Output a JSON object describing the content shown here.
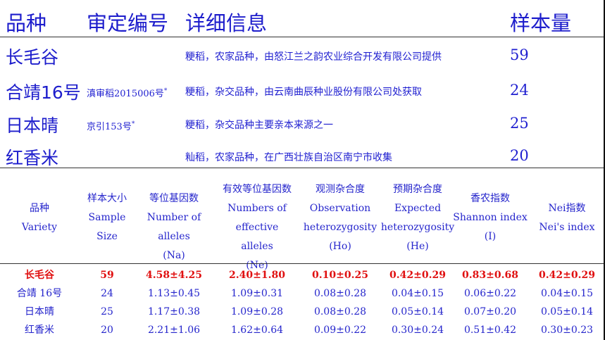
{
  "top_table": {
    "headers": [
      "品种",
      "审定编号",
      "详细信息",
      "样本量"
    ],
    "rows": [
      {
        "name": "长毛谷",
        "code": "",
        "mark": "",
        "desc": "粳稻，农家品种，由怒江兰之韵农业综合开发有限公司提供",
        "count": "59"
      },
      {
        "name": "合靖16号",
        "code": "滇审稻2015006号",
        "mark": "*",
        "desc": "粳稻，杂交品种，由云南曲辰种业股份有限公司处获取",
        "count": "24"
      },
      {
        "name": "日本晴",
        "code": "京引153号",
        "mark": "*",
        "desc": "粳稻，杂交品种主要亲本来源之一",
        "count": "25"
      },
      {
        "name": "红香米",
        "code": "",
        "mark": "",
        "desc": "籼稻，农家品种，在广西壮族自治区南宁市收集",
        "count": "20"
      }
    ]
  },
  "stats_table": {
    "headers": [
      [
        "品种",
        "Variety"
      ],
      [
        "样本大小",
        "Sample",
        "Size"
      ],
      [
        "等位基因数",
        "Number of alleles",
        "(Na)"
      ],
      [
        "有效等位基因数",
        "Numbers of",
        "effective alleles",
        "(Ne)"
      ],
      [
        "观测杂合度",
        "Observation",
        "heterozygosity",
        "(Ho)"
      ],
      [
        "预期杂合度",
        "Expected",
        "heterozygosity",
        "(He)"
      ],
      [
        "香农指数",
        "Shannon index",
        "(I)"
      ],
      [
        "Nei指数",
        "Nei's index"
      ]
    ],
    "rows": [
      [
        "长毛谷",
        "59",
        "4.58±4.25",
        "2.40±1.80",
        "0.10±0.25",
        "0.42±0.29",
        "0.83±0.68",
        "0.42±0.29"
      ],
      [
        "合靖 16号",
        "24",
        "1.13±0.45",
        "1.09±0.31",
        "0.08±0.28",
        "0.04±0.15",
        "0.06±0.22",
        "0.04±0.15"
      ],
      [
        "日本晴",
        "25",
        "1.17±0.38",
        "1.09±0.28",
        "0.08±0.28",
        "0.05±0.14",
        "0.07±0.20",
        "0.05±0.14"
      ],
      [
        "红香米",
        "20",
        "2.21±1.06",
        "1.62±0.64",
        "0.09±0.22",
        "0.30±0.24",
        "0.51±0.42",
        "0.30±0.23"
      ]
    ]
  },
  "colors": {
    "text": "#1f1fd0",
    "highlight": "#e01010"
  }
}
